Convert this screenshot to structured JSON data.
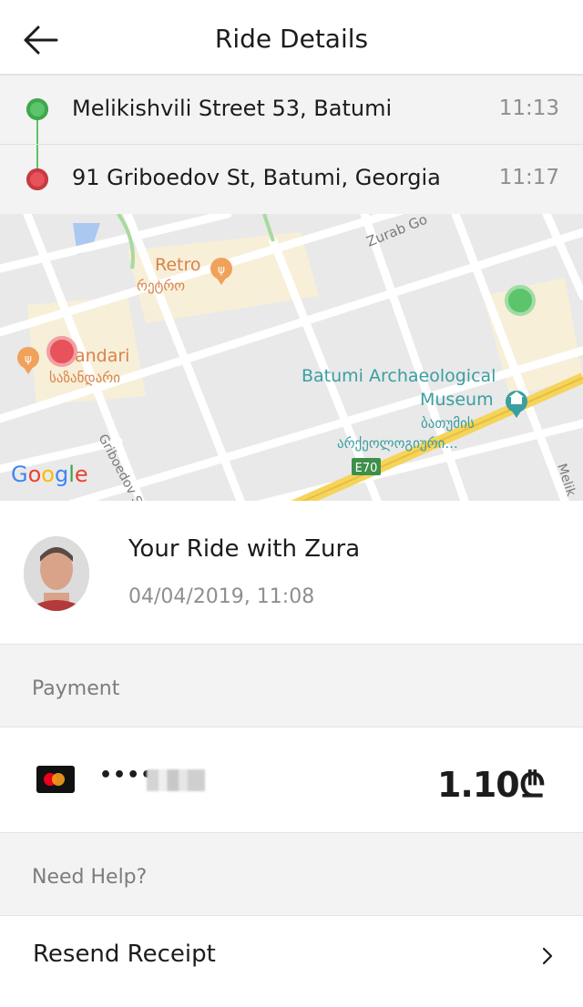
{
  "header": {
    "title": "Ride Details"
  },
  "route": {
    "pickup": {
      "address": "Melikishvili Street 53, Batumi",
      "time": "11:13"
    },
    "dropoff": {
      "address": "91 Griboedov St, Batumi, Georgia",
      "time": "11:17"
    }
  },
  "map": {
    "labels": {
      "retro_en": "Retro",
      "retro_ka": "რეტრო",
      "zandari_en": "zandari",
      "zandari_ka": "საზანდარი",
      "museum_line1": "Batumi Archaeological",
      "museum_line2": "Museum",
      "museum_ka1": "ბათუმის",
      "museum_ka2": "არქეოლოგიური...",
      "zurab": "Zurab Go",
      "griboedov": "Griboedov S",
      "melik": "Melik",
      "road_shield": "E70",
      "google": "Google"
    }
  },
  "driver": {
    "title": "Your Ride with Zura",
    "date": "04/04/2019, 11:08"
  },
  "payment": {
    "section_label": "Payment",
    "card_dots": "••••",
    "amount": "1.10₾"
  },
  "help": {
    "section_label": "Need Help?",
    "resend_label": "Resend Receipt"
  },
  "colors": {
    "pickup_green": "#5cc46a",
    "dropoff_red": "#e8525a",
    "poi_orange": "#f0a25a",
    "museum_teal": "#3b9ea0"
  },
  "icons": {
    "back": "arrow-left-icon",
    "card": "mastercard-icon",
    "chevron": "chevron-right-icon"
  }
}
